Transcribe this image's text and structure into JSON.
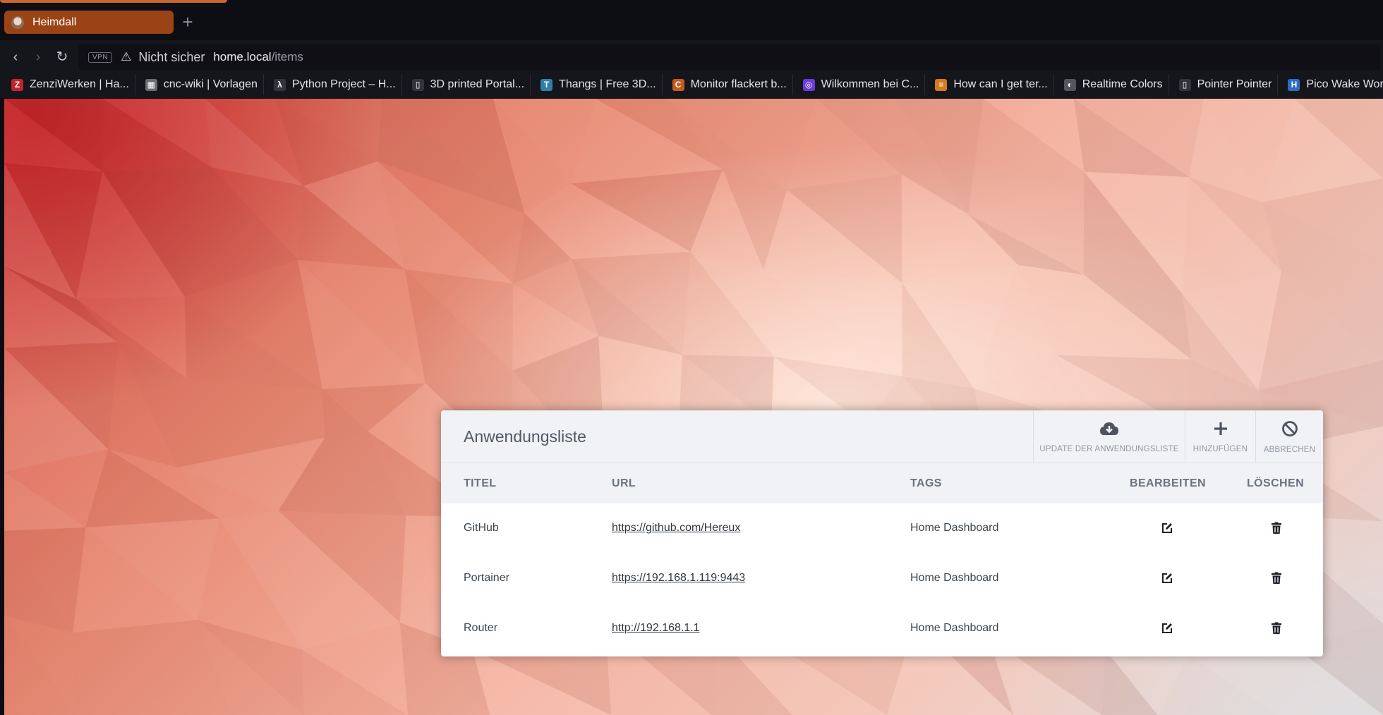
{
  "browser": {
    "tab_title": "Heimdall",
    "new_tab": "+",
    "vpn": "VPN",
    "insecure_label": "Nicht sicher",
    "url_host": "home.local",
    "url_path": "/items",
    "bookmarks": [
      {
        "label": "ZenziWerken | Ha...",
        "icon": "Z",
        "color": "#c0242b"
      },
      {
        "label": "cnc-wiki | Vorlagen",
        "icon": "▦",
        "color": "#6b6b73"
      },
      {
        "label": "Python Project – H...",
        "icon": "λ",
        "color": "#33333b"
      },
      {
        "label": "3D printed Portal...",
        "icon": "▯",
        "color": "#33333b"
      },
      {
        "label": "Thangs | Free 3D...",
        "icon": "T",
        "color": "#2f7fa8"
      },
      {
        "label": "Monitor flackert b...",
        "icon": "C",
        "color": "#c45a1e"
      },
      {
        "label": "Wilkommen bei C...",
        "icon": "◎",
        "color": "#6a3bd6"
      },
      {
        "label": "How can I get ter...",
        "icon": "≡",
        "color": "#d57a1e"
      },
      {
        "label": "Realtime Colors",
        "icon": "◐",
        "color": "#55555e"
      },
      {
        "label": "Pointer Pointer",
        "icon": "▯",
        "color": "#33333b"
      },
      {
        "label": "Pico Wake Word -",
        "icon": "H",
        "color": "#2d6cc0"
      }
    ]
  },
  "panel": {
    "title": "Anwendungsliste",
    "buttons": {
      "update": "UPDATE DER ANWENDUNGSLISTE",
      "add": "HINZUFÜGEN",
      "cancel": "ABBRECHEN"
    },
    "columns": {
      "title": "TITEL",
      "url": "URL",
      "tags": "TAGS",
      "edit": "BEARBEITEN",
      "delete": "LÖSCHEN"
    },
    "rows": [
      {
        "title": "GitHub",
        "url": "https://github.com/Hereux",
        "tags": "Home Dashboard"
      },
      {
        "title": "Portainer",
        "url": "https://192.168.1.119:9443",
        "tags": "Home Dashboard"
      },
      {
        "title": "Router",
        "url": "http://192.168.1.1",
        "tags": "Home Dashboard"
      }
    ]
  }
}
